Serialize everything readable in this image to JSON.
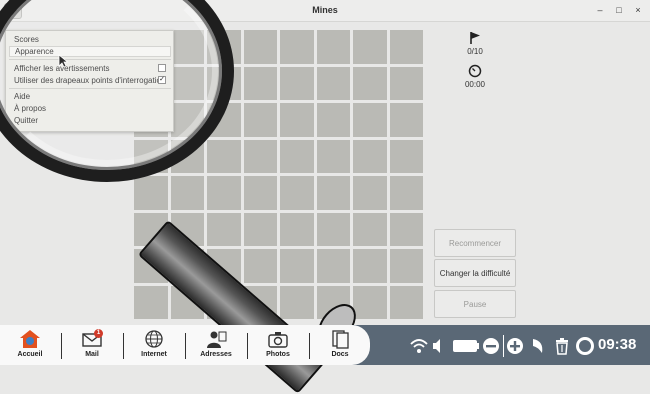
{
  "window": {
    "title": "Mines",
    "controls": [
      "–",
      "□",
      "×"
    ]
  },
  "menu": {
    "items": [
      {
        "label": "Scores"
      },
      {
        "label": "Apparence",
        "highlighted": true
      },
      {
        "label": "Afficher les avertissements",
        "checked": false
      },
      {
        "label": "Utiliser des drapeaux points d'interrogation",
        "checked": true
      },
      {
        "label": "Aide"
      },
      {
        "label": "À propos"
      },
      {
        "label": "Quitter"
      }
    ]
  },
  "status": {
    "flags": "0/10",
    "time": "00:00"
  },
  "buttons": {
    "restart": "Recommencer",
    "change_difficulty": "Changer la difficulté",
    "pause": "Pause"
  },
  "board": {
    "rows": 8,
    "cols": 8
  },
  "taskbar": {
    "apps": [
      {
        "label": "Accueil",
        "icon": "home-icon"
      },
      {
        "label": "Mail",
        "icon": "mail-icon",
        "badge": "1"
      },
      {
        "label": "Internet",
        "icon": "globe-icon"
      },
      {
        "label": "Adresses",
        "icon": "contacts-icon"
      },
      {
        "label": "Photos",
        "icon": "camera-icon"
      },
      {
        "label": "Docs",
        "icon": "docs-icon"
      }
    ],
    "clock": "09:38"
  },
  "colors": {
    "taskbar": "#5a6876",
    "cell": "#babab5",
    "background": "#e8e8e7"
  }
}
